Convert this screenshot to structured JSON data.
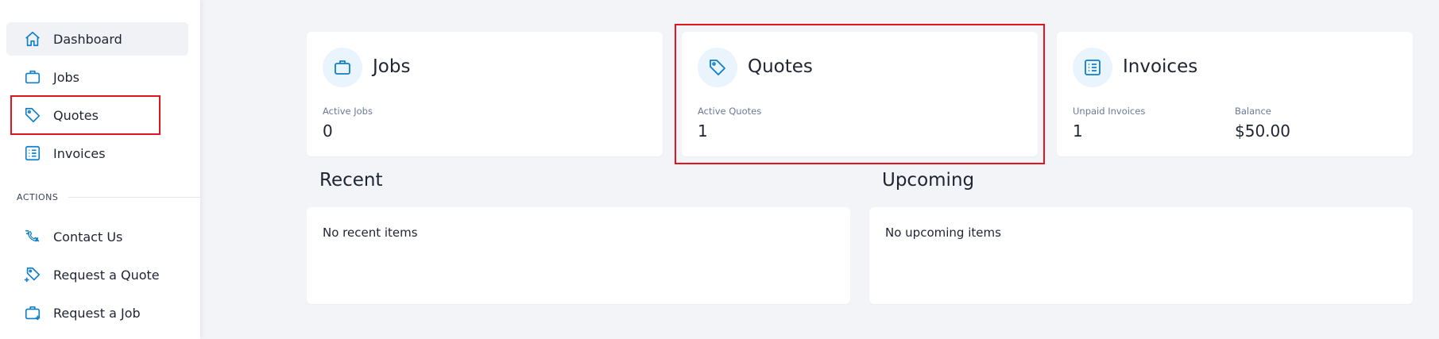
{
  "sidebar": {
    "items": [
      {
        "label": "Dashboard",
        "icon": "home-icon"
      },
      {
        "label": "Jobs",
        "icon": "briefcase-icon"
      },
      {
        "label": "Quotes",
        "icon": "tag-icon"
      },
      {
        "label": "Invoices",
        "icon": "invoice-list-icon"
      }
    ],
    "section_label": "ACTIONS",
    "actions": [
      {
        "label": "Contact Us",
        "icon": "contact-icon"
      },
      {
        "label": "Request a Quote",
        "icon": "tag-plus-icon"
      },
      {
        "label": "Request a Job",
        "icon": "briefcase-plus-icon"
      }
    ]
  },
  "stats": {
    "jobs": {
      "title": "Jobs",
      "label": "Active Jobs",
      "value": "0"
    },
    "quotes": {
      "title": "Quotes",
      "label": "Active Quotes",
      "value": "1"
    },
    "invoices": {
      "title": "Invoices",
      "label": "Unpaid Invoices",
      "value": "1",
      "balance_label": "Balance",
      "balance_value": "$50.00"
    }
  },
  "recent": {
    "heading": "Recent",
    "empty": "No recent items"
  },
  "upcoming": {
    "heading": "Upcoming",
    "empty": "No upcoming items"
  },
  "colors": {
    "accent": "#0f7fc8",
    "highlight": "#e3141b",
    "background": "#f3f4f8"
  }
}
